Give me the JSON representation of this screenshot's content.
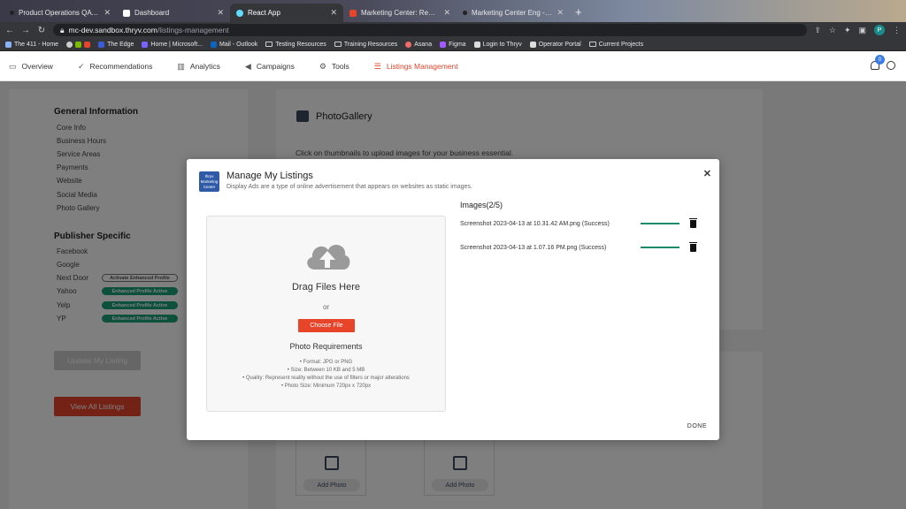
{
  "browser": {
    "tabs": [
      {
        "title": "Product Operations QA Team",
        "fav_color": "#e8442a",
        "active": false
      },
      {
        "title": "Dashboard",
        "fav_color": "#ffffff",
        "active": false
      },
      {
        "title": "React App",
        "fav_color": "#61dafb",
        "active": true
      },
      {
        "title": "Marketing Center: Report An Issue",
        "fav_color": "#e8442a",
        "active": false
      },
      {
        "title": "Marketing Center Eng - Asana",
        "fav_color": "#e8442a",
        "active": false
      }
    ],
    "new_tab": "+",
    "url_host": "mc-dev.sandbox.thryv.com",
    "url_path": "/listings-management",
    "profile_initial": "P",
    "bookmarks": [
      "The 411 - Home",
      "The Edge",
      "Home | Microsoft...",
      "Mail - Outlook",
      "Testing Resources",
      "Training Resources",
      "Asana",
      "Figma",
      "Login to Thryv",
      "Operator Portal",
      "Current Projects"
    ]
  },
  "nav": {
    "items": [
      {
        "label": "Overview",
        "icon": "monitor-icon"
      },
      {
        "label": "Recommendations",
        "icon": "thumbs-up-icon"
      },
      {
        "label": "Analytics",
        "icon": "bar-chart-icon"
      },
      {
        "label": "Campaigns",
        "icon": "megaphone-icon"
      },
      {
        "label": "Tools",
        "icon": "gear-icon"
      },
      {
        "label": "Listings Management",
        "icon": "list-icon"
      }
    ],
    "notification_count": "0"
  },
  "sidebar": {
    "general_title": "General Information",
    "general_items": [
      "Core Info",
      "Business Hours",
      "Service Areas",
      "Payments",
      "Website",
      "Social Media",
      "Photo Gallery"
    ],
    "publisher_title": "Publisher Specific",
    "publisher_items": [
      "Facebook",
      "Google",
      "Next Door",
      "Yahoo",
      "Yelp",
      "YP"
    ],
    "pills": {
      "nextdoor": "Activate Enhanced Profile",
      "yahoo": "Enhanced Profile Active",
      "yelp": "Enhanced Profile Active",
      "yp": "Enhanced Profile Active"
    },
    "update_button": "Update My Listing",
    "view_button": "View All Listings"
  },
  "photo_gallery": {
    "title": "PhotoGallery",
    "subtitle": "Click on thumbnails to upload images for your business essential.",
    "add_photo": "Add Photo"
  },
  "modal": {
    "logo_text": "thryv Marketing Center",
    "title": "Manage My Listings",
    "subtitle": "Display Ads are a type of online advertisement that appears on websites as static images.",
    "drag_title": "Drag Files Here",
    "or": "or",
    "choose_button": "Choose File",
    "req_title": "Photo Requirements",
    "requirements": [
      "• Format: JPG or PNG",
      "• Size: Between 10 KB and 5 MB",
      "• Quality: Represent reality without the use of filters or major alterations",
      "• Photo Size: Minimum 720px x 720px"
    ],
    "images_title": "Images(2/5)",
    "files": [
      {
        "name": "Screenshot 2023-04-13 at 10.31.42 AM.png (Success)",
        "progress": 1.0
      },
      {
        "name": "Screenshot 2023-04-13 at 1.07.16 PM.png (Success)",
        "progress": 1.0
      }
    ],
    "done": "DONE"
  }
}
